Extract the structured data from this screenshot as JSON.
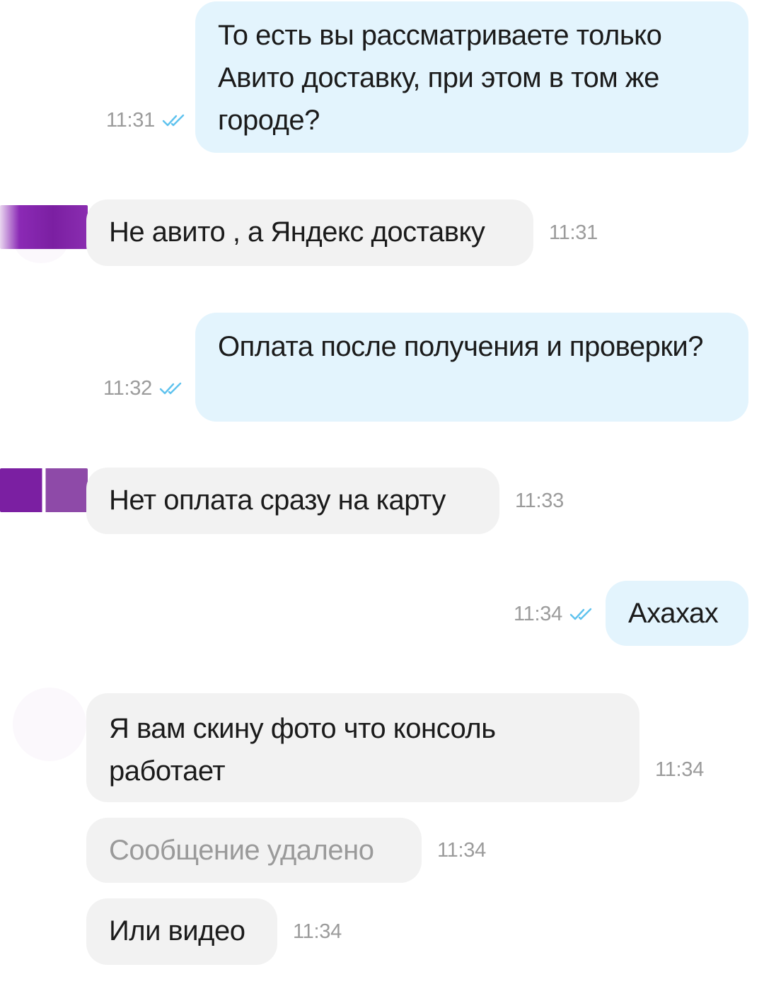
{
  "messages": [
    {
      "id": 1,
      "direction": "outgoing",
      "text": "То есть вы рассматриваете только Авито доставку, при этом в том же городе?",
      "time": "11:31",
      "read": true
    },
    {
      "id": 2,
      "direction": "incoming",
      "text": "Не авито , а Яндекс доставку",
      "time": "11:31"
    },
    {
      "id": 3,
      "direction": "outgoing",
      "text": "Оплата после получения и проверки?",
      "time": "11:32",
      "read": true
    },
    {
      "id": 4,
      "direction": "incoming",
      "text": "Нет оплата сразу на карту",
      "time": "11:33"
    },
    {
      "id": 5,
      "direction": "outgoing",
      "text": "Ахахах",
      "time": "11:34",
      "read": true
    },
    {
      "id": 6,
      "direction": "incoming",
      "text": "Я вам скину фото что консоль работает",
      "time": "11:34"
    },
    {
      "id": 7,
      "direction": "incoming",
      "text": "Сообщение удалено",
      "time": "11:34",
      "deleted": true
    },
    {
      "id": 8,
      "direction": "incoming",
      "text": "Или видео",
      "time": "11:34"
    }
  ],
  "colors": {
    "outgoing_bubble": "#e3f4fd",
    "incoming_bubble": "#f2f2f2",
    "read_check": "#5ec2ee",
    "timestamp": "#9b9b9b",
    "deleted_text": "#9a9a9a",
    "avatar_censor": "#7b1fa2"
  },
  "icons": {
    "read_status": "double-check-icon"
  }
}
